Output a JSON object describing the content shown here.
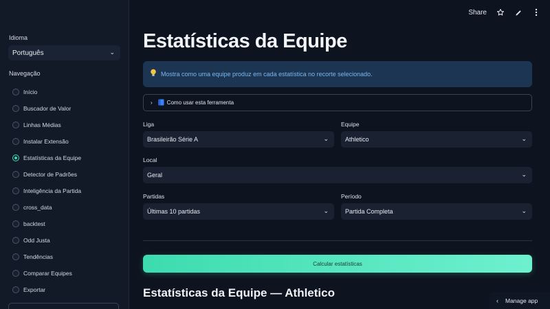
{
  "header": {
    "share_label": "Share",
    "icons": [
      "star-icon",
      "pencil-icon",
      "kebab-menu-icon"
    ]
  },
  "sidebar": {
    "language_label": "Idioma",
    "language_value": "Português",
    "nav_label": "Navegação",
    "items": [
      {
        "label": "Início",
        "selected": false
      },
      {
        "label": "Buscador de Valor",
        "selected": false
      },
      {
        "label": "Linhas Médias",
        "selected": false
      },
      {
        "label": "Instalar Extensão",
        "selected": false
      },
      {
        "label": "Estatísticas da Equipe",
        "selected": true
      },
      {
        "label": "Detector de Padrões",
        "selected": false
      },
      {
        "label": "Inteligência da Partida",
        "selected": false
      },
      {
        "label": "cross_data",
        "selected": false
      },
      {
        "label": "backtest",
        "selected": false
      },
      {
        "label": "Odd Justa",
        "selected": false
      },
      {
        "label": "Tendências",
        "selected": false
      },
      {
        "label": "Comparar Equipes",
        "selected": false
      },
      {
        "label": "Exportar",
        "selected": false
      }
    ]
  },
  "main": {
    "title": "Estatísticas da Equipe",
    "info_text": "Mostra como uma equipe produz em cada estatística no recorte selecionado.",
    "expander_label": "Como usar esta ferramenta",
    "fields": {
      "liga_label": "Liga",
      "liga_value": "Brasileirão Série A",
      "equipe_label": "Equipe",
      "equipe_value": "Athletico",
      "local_label": "Local",
      "local_value": "Geral",
      "partidas_label": "Partidas",
      "partidas_value": "Últimas 10 partidas",
      "periodo_label": "Período",
      "periodo_value": "Partida Completa"
    },
    "calc_button": "Calcular estatísticas",
    "section_title": "Estatísticas da Equipe — Athletico"
  },
  "footer": {
    "manage_app": "Manage app"
  },
  "colors": {
    "accent": "#3dd9b3",
    "background": "#0d1420",
    "sidebar": "#121a28",
    "info_bg": "#1c3552",
    "info_text": "#7ab8f0"
  }
}
